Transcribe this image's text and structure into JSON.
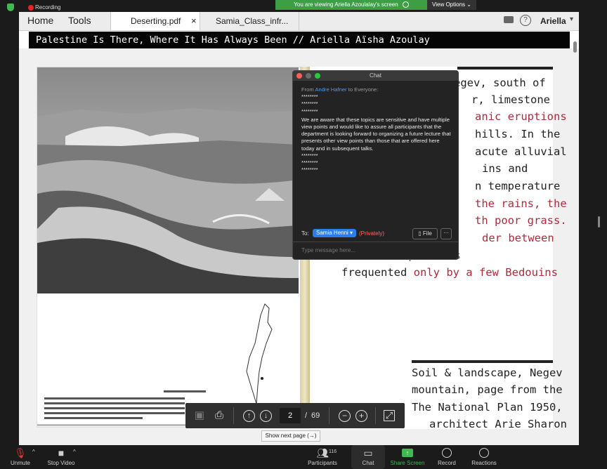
{
  "recording": {
    "label": "Recording"
  },
  "banner": {
    "text": "You are viewing Ariella Azoulalay's screen",
    "view_options": "View Options"
  },
  "browser": {
    "nav": {
      "home": "Home",
      "tools": "Tools"
    },
    "tabs": [
      {
        "label": "Deserting.pdf",
        "close": "×"
      },
      {
        "label": "Samia_Class_infr..."
      }
    ],
    "user": "Ariella",
    "help_glyph": "?"
  },
  "document": {
    "title": "Palestine Is There, Where It Has Always Been // Ariella Aïsha Azoulay",
    "right_text": {
      "lines": [
        {
          "a": "egev, south of",
          "b": ""
        },
        {
          "a": "r, limestone",
          "b": ""
        },
        {
          "a": "",
          "b": "anic eruptions"
        },
        {
          "a": "hills. In the",
          "b": ""
        },
        {
          "a": "acute alluvial",
          "b": ""
        },
        {
          "a": "ins and",
          "b": ""
        },
        {
          "a": "n temperature",
          "b": ""
        },
        {
          "a": "",
          "b": "the rains, the"
        },
        {
          "a": "",
          "b": "th poor grass."
        },
        {
          "a": "",
          "b": "der between"
        },
        {
          "a": "",
          "b": "the pastures"
        },
        {
          "a": "frequented ",
          "b": "only by a few Bedouins"
        }
      ]
    },
    "caption": [
      "Soil & landscape, Negev",
      "mountain, page from the",
      "The National Plan 1950,",
      "architect Arie Sharon"
    ]
  },
  "chat": {
    "title": "Chat",
    "from_prefix": "From",
    "from_name": "Andre Hafner",
    "from_suffix": "to Everyone:",
    "stars": "********",
    "message": "We are aware that these topics are sensitive and have multiple view points and would like to assure all participants that the department is looking forward to organizing a future lecture that presents other view points than those that are offered here today and in subsequent talks.",
    "to_label": "To:",
    "recipient": "Samia Henni",
    "privately": "(Privately)",
    "file_button": "File",
    "more": "···",
    "input_placeholder": "Type message here..."
  },
  "pdf_toolbar": {
    "page": "2",
    "separator": "/",
    "total": "69",
    "tooltip": "Show next page (→)"
  },
  "zoom_bar": {
    "unmute": "Unmute",
    "stop_video": "Stop Video",
    "participants": "Participants",
    "participants_count": "116",
    "chat": "Chat",
    "share_screen": "Share Screen",
    "record": "Record",
    "reactions": "Reactions"
  },
  "colors": {
    "chat_link": "#4a9bff",
    "privately": "#ff6b5f",
    "recipient_bg": "#2b7de9",
    "share_green": "#3fb950",
    "text_red": "#b02a3a"
  }
}
